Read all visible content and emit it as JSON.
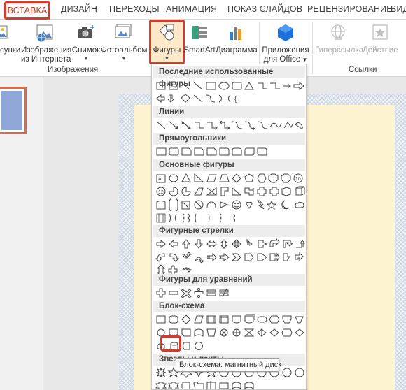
{
  "tabs": [
    {
      "label": "ВСТАВКА",
      "active": true
    },
    {
      "label": "ДИЗАЙН"
    },
    {
      "label": "ПЕРЕХОДЫ"
    },
    {
      "label": "АНИМАЦИЯ"
    },
    {
      "label": "ПОКАЗ СЛАЙДОВ"
    },
    {
      "label": "РЕЦЕНЗИРОВАНИЕ"
    },
    {
      "label": "ВИД"
    }
  ],
  "ribbon": {
    "pictures_line": "сунки",
    "online_images_line1": "Изображения",
    "online_images_line2": "из Интернета",
    "snapshot": "Снимок",
    "photo_album": "Фотоальбом",
    "shapes": "Фигуры",
    "smartart": "SmartArt",
    "chart": "Диаграмма",
    "apps_line1": "Приложения",
    "apps_line2": "для Office",
    "hyperlink": "Гиперссылка",
    "action": "Действие",
    "group_images": "Изображения",
    "group_links": "Ссылки"
  },
  "shapes_gallery": {
    "sections": [
      "Последние использованные фигуры",
      "Линии",
      "Прямоугольники",
      "Основные фигуры",
      "Фигурные стрелки",
      "Фигуры для уравнений",
      "Блок-схема",
      "Звезды и ленты"
    ],
    "tooltip": "Блок-схема: магнитный диск",
    "highlighted_shape": "flowchart-magnetic-disk"
  },
  "colors": {
    "accent_red": "#d53a2c",
    "tab_active_text": "#c4432d",
    "slide_paper": "#fef3d0",
    "thumb_fill": "#8fa8d8"
  }
}
